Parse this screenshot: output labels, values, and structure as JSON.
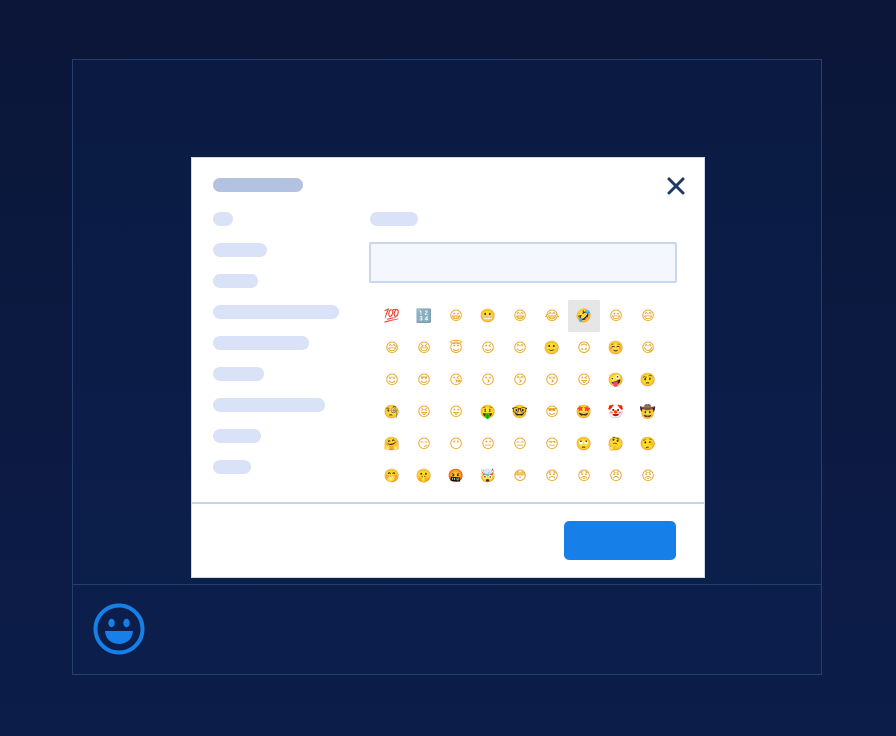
{
  "colors": {
    "page_background": "#0b1638",
    "frame_border": "#24406f",
    "accent_blue": "#1680e8",
    "close_icon": "#1e3a66",
    "placeholder_bar": "#d9e2f6",
    "title_placeholder_bar": "#b4c2e2",
    "selected_emoji_bg": "#e6e6e6"
  },
  "bottom_bar": {
    "emoji_button_icon": "smiley-icon"
  },
  "dialog": {
    "close_icon": "close-icon",
    "search": {
      "value": "",
      "placeholder": ""
    },
    "emojis": [
      "💯",
      "🔢",
      "😀",
      "😬",
      "😁",
      "😂",
      "🤣",
      "😃",
      "😄",
      "😅",
      "😆",
      "😇",
      "😉",
      "😊",
      "🙂",
      "🙃",
      "☺️",
      "😋",
      "😌",
      "😍",
      "😘",
      "😗",
      "😙",
      "😚",
      "😜",
      "🤪",
      "🤨",
      "🧐",
      "😝",
      "😛",
      "🤑",
      "🤓",
      "😎",
      "🤩",
      "🤡",
      "🤠",
      "🤗",
      "😏",
      "😶",
      "😐",
      "😑",
      "😒",
      "🙄",
      "🤔",
      "🤥",
      "🤭",
      "🤫",
      "🤬",
      "🤯",
      "😳",
      "😞",
      "😟",
      "😠",
      "😡"
    ],
    "selected_index": 6,
    "confirm_label": ""
  }
}
